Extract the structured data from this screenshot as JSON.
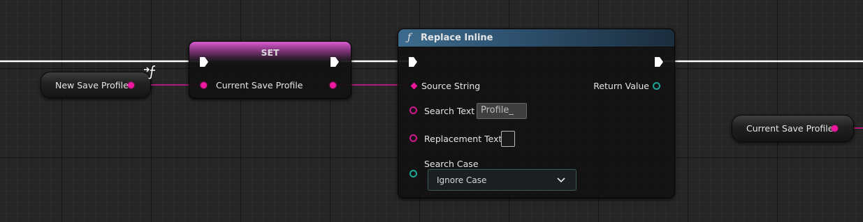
{
  "nodes": {
    "new_save_profile": {
      "label": "New Save Profile",
      "icon": "function-icon"
    },
    "set": {
      "title": "SET",
      "pin_label": "Current Save Profile"
    },
    "replace_inline": {
      "title": "Replace Inline",
      "title_icon": "function-icon",
      "inputs": {
        "source_string": "Source String",
        "search_text": "Search Text",
        "search_text_value": "Profile_",
        "replacement_text": "Replacement Text",
        "replacement_text_value": "",
        "search_case": "Search Case",
        "search_case_value": "Ignore Case"
      },
      "outputs": {
        "return_value": "Return Value"
      }
    },
    "current_save_profile_getter": {
      "label": "Current Save Profile"
    }
  },
  "colors": {
    "string_pin": "#f0179f",
    "enum_pin": "#1da598",
    "exec_wire": "#ffffff",
    "function_header": "#3d6b8d",
    "set_header": "#d85cd0"
  }
}
